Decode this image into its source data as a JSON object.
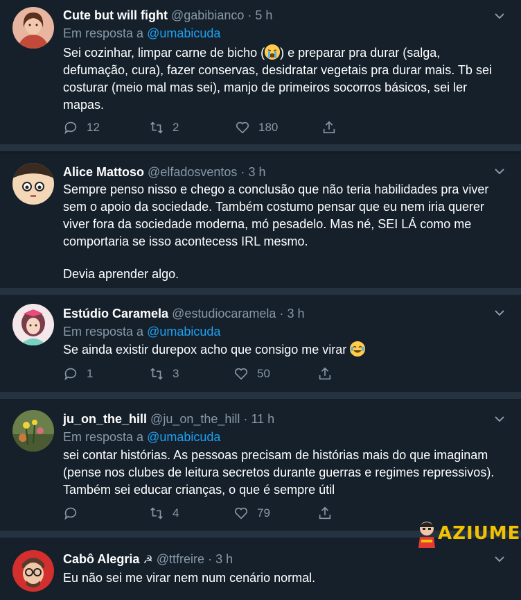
{
  "tweets": [
    {
      "name": "Cute but will fight",
      "handle": "@gabibianco",
      "time": "5 h",
      "reply_prefix": "Em resposta a",
      "reply_to": "@umabicuda",
      "text_a": "Sei cozinhar, limpar carne de bicho  (",
      "text_b": ") e preparar pra durar (salga, defumação, cura),  fazer conservas, desidratar vegetais pra durar mais. Tb sei costurar (meio mal mas sei), manjo de primeiros socorros básicos, sei ler mapas.",
      "replies": "12",
      "retweets": "2",
      "likes": "180"
    },
    {
      "name": "Alice Mattoso",
      "handle": "@elfadosventos",
      "time": "3 h",
      "text_a": "Sempre penso nisso e chego a conclusão que não teria habilidades pra viver sem o apoio da sociedade. Também costumo pensar que eu nem iria querer viver fora da sociedade moderna, mó pesadelo. Mas né, SEI LÁ como me comportaria se isso acontecess IRL mesmo.",
      "text_b": "Devia aprender algo."
    },
    {
      "name": "Estúdio Caramela",
      "handle": "@estudiocaramela",
      "time": "3 h",
      "reply_prefix": "Em resposta a",
      "reply_to": "@umabicuda",
      "text_a": "Se ainda existir durepox acho que consigo me virar",
      "replies": "1",
      "retweets": "3",
      "likes": "50"
    },
    {
      "name": "ju_on_the_hill",
      "handle": "@ju_on_the_hill",
      "time": "11 h",
      "reply_prefix": "Em resposta a",
      "reply_to": "@umabicuda",
      "text_a": "sei contar histórias. As pessoas precisam de histórias mais do que imaginam (pense nos clubes de leitura secretos durante guerras e regimes repressivos). Também sei educar crianças, o que é sempre útil",
      "replies": "",
      "retweets": "4",
      "likes": "79"
    },
    {
      "name": "Cabô Alegria",
      "handle": "@ttfreire",
      "time": "3 h",
      "text_a": "Eu não sei me virar nem num cenário normal."
    }
  ],
  "watermark": "AZIUME",
  "colors": {
    "background": "#15202b",
    "separator": "#253341",
    "muted": "#8899a6",
    "link": "#1da1f2"
  }
}
